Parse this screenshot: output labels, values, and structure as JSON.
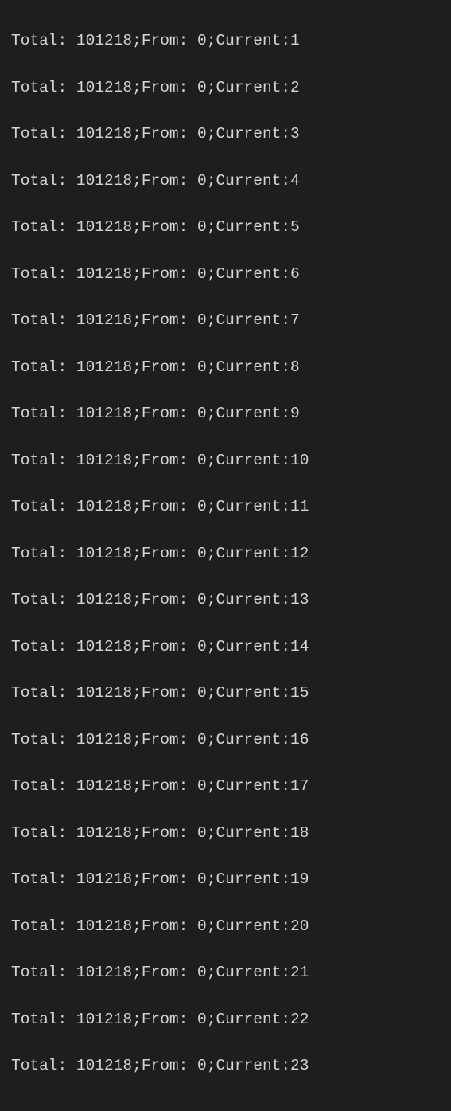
{
  "terminal": {
    "lines": [
      "Total: 101218;From: 0;Current:1",
      "Total: 101218;From: 0;Current:2",
      "Total: 101218;From: 0;Current:3",
      "Total: 101218;From: 0;Current:4",
      "Total: 101218;From: 0;Current:5",
      "Total: 101218;From: 0;Current:6",
      "Total: 101218;From: 0;Current:7",
      "Total: 101218;From: 0;Current:8",
      "Total: 101218;From: 0;Current:9",
      "Total: 101218;From: 0;Current:10",
      "Total: 101218;From: 0;Current:11",
      "Total: 101218;From: 0;Current:12",
      "Total: 101218;From: 0;Current:13",
      "Total: 101218;From: 0;Current:14",
      "Total: 101218;From: 0;Current:15",
      "Total: 101218;From: 0;Current:16",
      "Total: 101218;From: 0;Current:17",
      "Total: 101218;From: 0;Current:18",
      "Total: 101218;From: 0;Current:19",
      "Total: 101218;From: 0;Current:20",
      "Total: 101218;From: 0;Current:21",
      "Total: 101218;From: 0;Current:22",
      "Total: 101218;From: 0;Current:23"
    ]
  }
}
